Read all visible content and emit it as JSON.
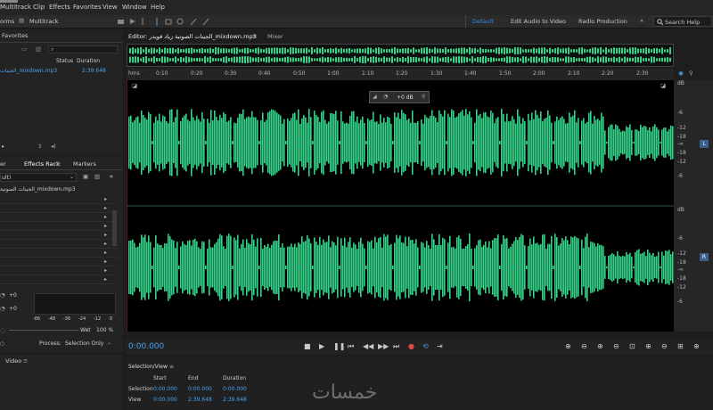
{
  "menu": {
    "items": [
      "Multitrack",
      "Clip",
      "Effects",
      "Favorites",
      "View",
      "Window",
      "Help"
    ]
  },
  "toolbar": {
    "mode_left": "orms",
    "multitrack_label": "Multitrack",
    "workspaces": [
      "Default",
      "Edit Audio to Video",
      "Radio Production"
    ],
    "search_placeholder": "Search Help"
  },
  "files_panel": {
    "tab_label": "Favorites",
    "columns": [
      "Status",
      "Duration"
    ],
    "file_name": "الجينات_mixdown.mp3",
    "file_duration": "2:39.648"
  },
  "effects_panel": {
    "tabs": [
      "er",
      "Effects Rack",
      "Markers"
    ],
    "preset": "ult)",
    "file_label": "الجينات الصوتية_mixdown.mp3",
    "process_label": "Process:",
    "process_value": "Selection Only",
    "scale_labels": [
      "-86",
      "-48",
      "-36",
      "-24",
      "-12",
      "0"
    ],
    "wet_label": "Wet",
    "percent_label": "100 %",
    "input_labels": [
      "+0",
      "+0"
    ]
  },
  "video_panel": {
    "tab_label": "Video"
  },
  "editor": {
    "tab_label": "Editor: الجينات الصوتية زياد قويدر_mixdown.mp3",
    "mixer_label": "Mixer",
    "ruler_unit": "hms",
    "ruler_ticks": [
      "0:10",
      "0:20",
      "0:30",
      "0:40",
      "0:50",
      "1:00",
      "1:10",
      "1:20",
      "1:30",
      "1:40",
      "1:50",
      "2:00",
      "2:10",
      "2:20",
      "2:30"
    ],
    "hud_gain": "+0 dB",
    "channel_badges": [
      "L",
      "R"
    ],
    "db_scale": [
      "dB",
      "-6",
      "-12",
      "-18",
      "-∞",
      "-18",
      "-12",
      "-6"
    ],
    "wave_color": "#35d28a"
  },
  "transport": {
    "timecode": "0:00.000"
  },
  "selection_view": {
    "title": "Selection/View",
    "headers": [
      "Start",
      "End",
      "Duration"
    ],
    "rows": [
      {
        "label": "Selection",
        "start": "0:00.000",
        "end": "0:00.000",
        "duration": "0:00.000"
      },
      {
        "label": "View",
        "start": "0:00.000",
        "end": "2:39.648",
        "duration": "2:39.648"
      }
    ]
  },
  "watermark": "خمسات"
}
